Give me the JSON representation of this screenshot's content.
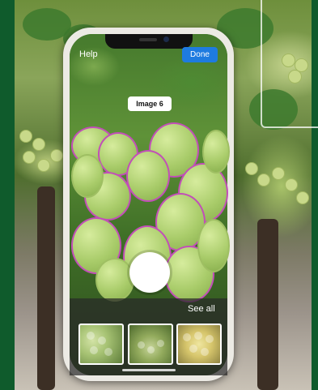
{
  "header": {
    "help_label": "Help",
    "done_label": "Done"
  },
  "camera": {
    "image_label": "Image 6"
  },
  "gallery": {
    "see_all_label": "See all",
    "thumbnails": [
      "grapes-thumbnail-1",
      "grapes-thumbnail-2",
      "grapes-thumbnail-3"
    ]
  },
  "colors": {
    "accent": "#1e7be0",
    "outline": "#c24fb8",
    "frame_background": "#0f5b2c"
  }
}
